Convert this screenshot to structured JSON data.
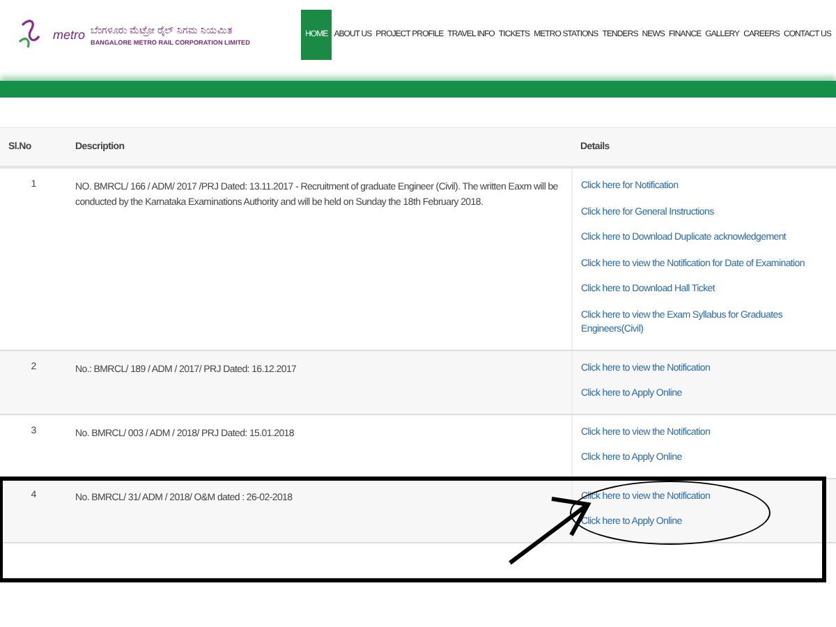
{
  "logo": {
    "mark": "metro",
    "name_kannada": "ಬೆಂಗಳೂರು ಮೆಟ್ರೋ ರೈಲ್ ನಿಗಮ ನಿಯಮಿತ",
    "name_english": "BANGALORE METRO RAIL CORPORATION LIMITED"
  },
  "nav": [
    {
      "label": "HOME",
      "selected": true
    },
    {
      "label": "ABOUT US",
      "selected": false
    },
    {
      "label": "PROJECT PROFILE",
      "selected": false
    },
    {
      "label": "TRAVEL INFO",
      "selected": false
    },
    {
      "label": "TICKETS",
      "selected": false
    },
    {
      "label": "METRO STATIONS",
      "selected": false
    },
    {
      "label": "TENDERS",
      "selected": false
    },
    {
      "label": "NEWS",
      "selected": false
    },
    {
      "label": "FINANCE",
      "selected": false
    },
    {
      "label": "GALLERY",
      "selected": false
    },
    {
      "label": "CAREERS",
      "selected": false
    },
    {
      "label": "CONTACT US",
      "selected": false
    }
  ],
  "table": {
    "columns": [
      "Sl.No",
      "Description",
      "Details"
    ],
    "rows": [
      {
        "sl_no": "1",
        "description": "NO. BMRCL/ 166 / ADM/ 2017 /PRJ Dated: 13.11.2017 - Recruitment of graduate Engineer (Civil). The written Eaxm will be conducted by the Karnataka Examinations Authority and will be held on Sunday the 18th February 2018.",
        "links": [
          "Click here for Notification",
          "Click here for General Instructions",
          "Click here to Download Duplicate acknowledgement",
          "Click here to view the Notification for Date of Examination",
          "Click here to Download Hall Ticket",
          "Click here to view the Exam Syllabus for Graduates Engineers(Civil)"
        ],
        "highlighted": false
      },
      {
        "sl_no": "2",
        "description": "No.: BMRCL/ 189 / ADM / 2017/ PRJ Dated: 16.12.2017",
        "links": [
          "Click here to view the Notification",
          "Click here to Apply Online"
        ],
        "highlighted": false
      },
      {
        "sl_no": "3",
        "description": "No. BMRCL/ 003 / ADM / 2018/ PRJ Dated: 15.01.2018",
        "links": [
          "Click here to view the Notification",
          "Click here to Apply Online"
        ],
        "highlighted": false
      },
      {
        "sl_no": "4",
        "description": "No. BMRCL/ 31/ ADM / 2018/ O&M dated : 26-02-2018",
        "links": [
          "Click here to view the Notification",
          "Click here to Apply Online"
        ],
        "highlighted": true
      }
    ]
  }
}
